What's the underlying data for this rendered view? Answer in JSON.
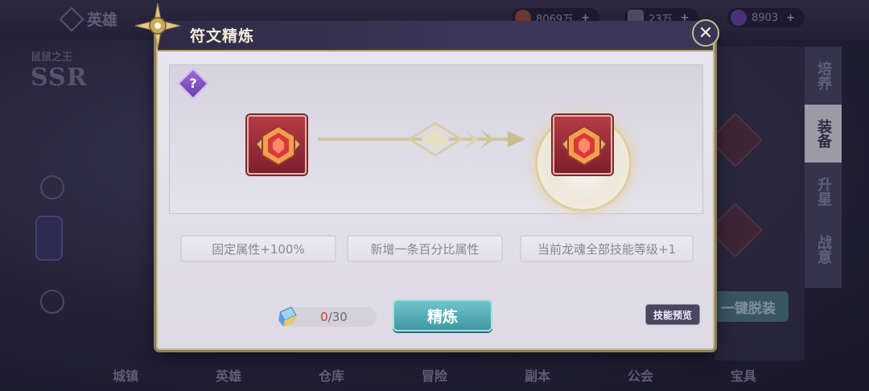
{
  "background": {
    "hero_tab": "英雄",
    "rarity": "SSR",
    "hero_name": "鼠鼠之王",
    "resources": [
      {
        "value": "8069万",
        "icon": "gold-coin-icon"
      },
      {
        "value": "23万",
        "icon": "potion-icon"
      },
      {
        "value": "8903",
        "icon": "purple-gem-icon"
      }
    ],
    "right_tabs": [
      "培养",
      "装备",
      "升星",
      "战意"
    ],
    "unequip_label": "一键脱装",
    "bottom_nav": [
      "城镇",
      "英雄",
      "仓库",
      "冒险",
      "副本",
      "公会",
      "宝具"
    ]
  },
  "modal": {
    "title": "符文精炼",
    "close_icon": "close-icon",
    "help_label": "?",
    "attributes": [
      "固定属性+100%",
      "新增一条百分比属性",
      "当前龙魂全部技能等级+1"
    ],
    "material": {
      "current": "0",
      "required": "/30"
    },
    "refine_label": "精炼",
    "skill_preview_label": "技能预览"
  },
  "colors": {
    "accent_gold": "#c9b98e",
    "title_bar": "#3c3757",
    "refine_button": "#4fa7af",
    "gem_red": "#b43b46",
    "insufficient": "#d23a3a"
  }
}
